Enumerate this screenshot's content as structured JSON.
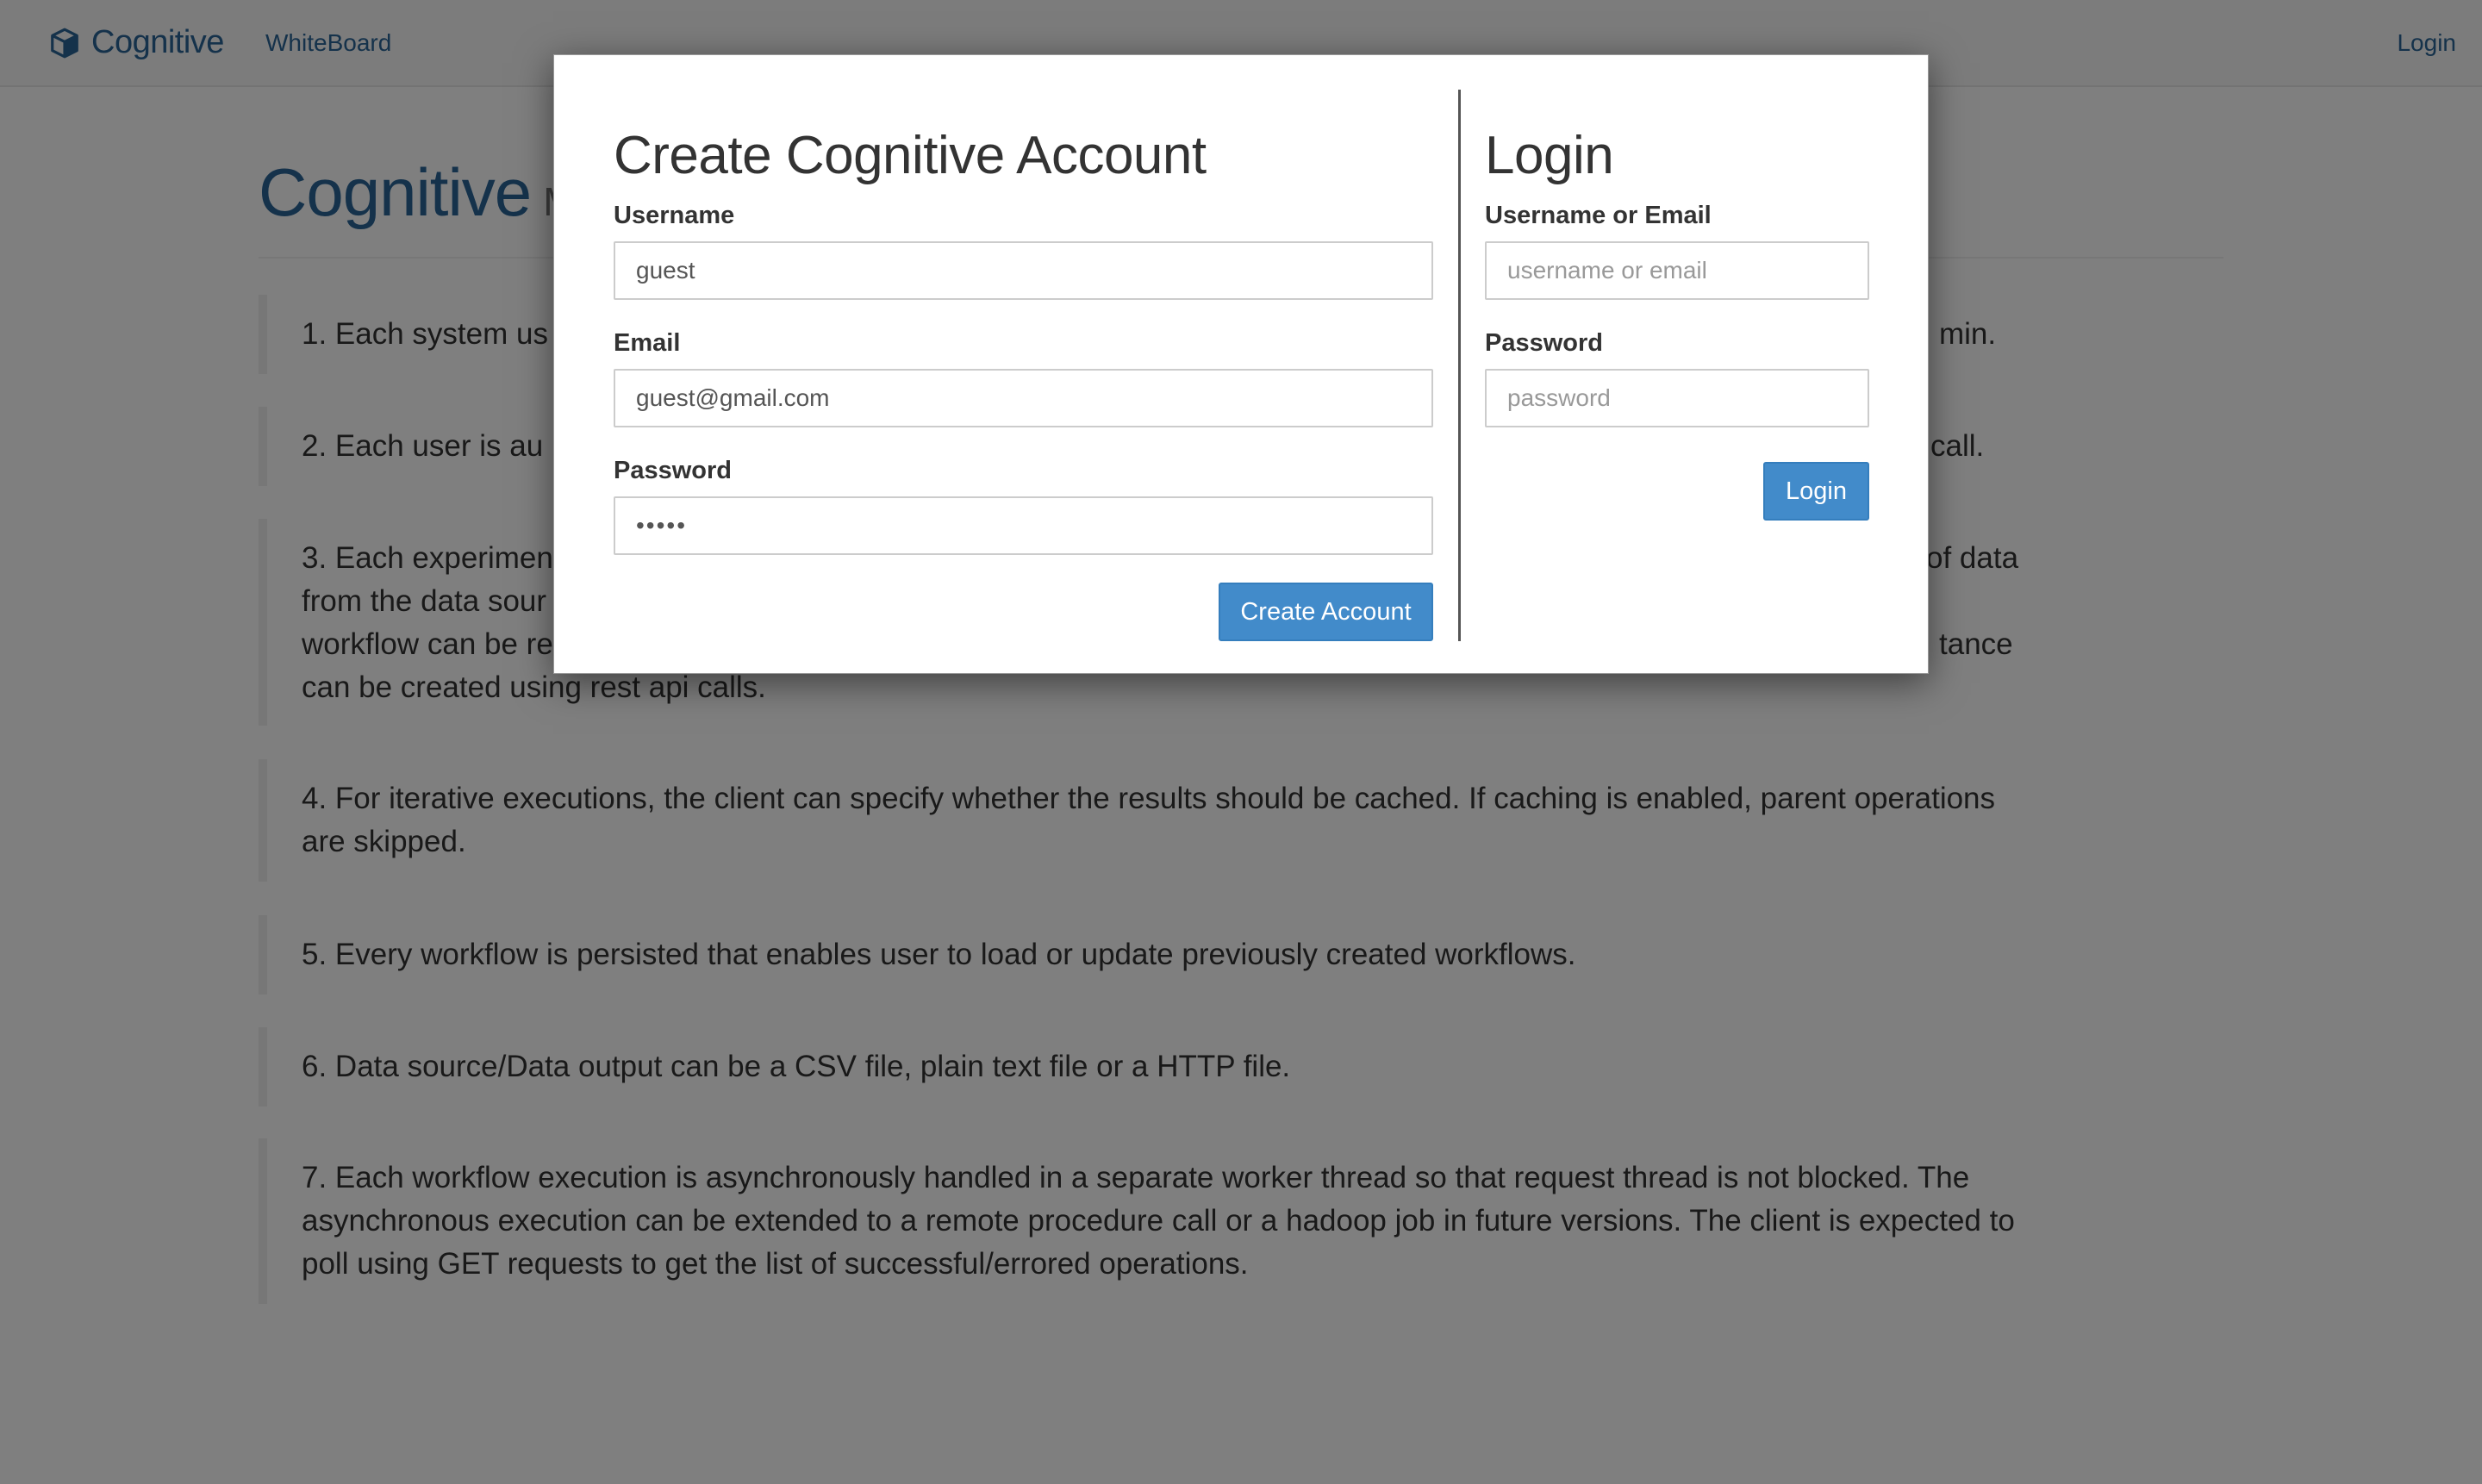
{
  "navbar": {
    "brand": "Cognitive",
    "whiteboard_link": "WhiteBoard",
    "login_link": "Login"
  },
  "page": {
    "title": "Cognitive",
    "title_small": "M",
    "features": [
      "1. Each system us",
      "2. Each user is au",
      "3. Each experimen",
      "4. For iterative executions, the client can specify whether the results should be cached. If caching is enabled, parent operations are skipped.",
      "5. Every workflow is persisted that enables user to load or update previously created workflows.",
      "6. Data source/Data output can be a CSV file, plain text file or a HTTP file.",
      "7. Each workflow execution is asynchronously handled in a separate worker thread so that request thread is not blocked. The asynchronous execution can be extended to a remote procedure call or a hadoop job in future versions. The client is expected to poll using GET requests to get the list of successful/errored operations."
    ],
    "feature_fragments": {
      "f1_right": "min.",
      "f2_right": "call.",
      "f3_line1_right": "of data",
      "f3_line2_left": "from the data sour",
      "f3_line3_left": "workflow can be re",
      "f3_line3_right": "tance",
      "f3_line4": "can be created using rest api calls."
    }
  },
  "create_account": {
    "title": "Create Cognitive Account",
    "username_label": "Username",
    "username_value": "guest",
    "email_label": "Email",
    "email_value": "guest@gmail.com",
    "password_label": "Password",
    "password_value": "guest",
    "button": "Create Account"
  },
  "login": {
    "title": "Login",
    "username_label": "Username or Email",
    "username_placeholder": "username or email",
    "password_label": "Password",
    "password_placeholder": "password",
    "button": "Login"
  },
  "colors": {
    "brand": "#2a6496",
    "primary_button": "#428bca",
    "backdrop": "rgba(0,0,0,0.5)"
  }
}
